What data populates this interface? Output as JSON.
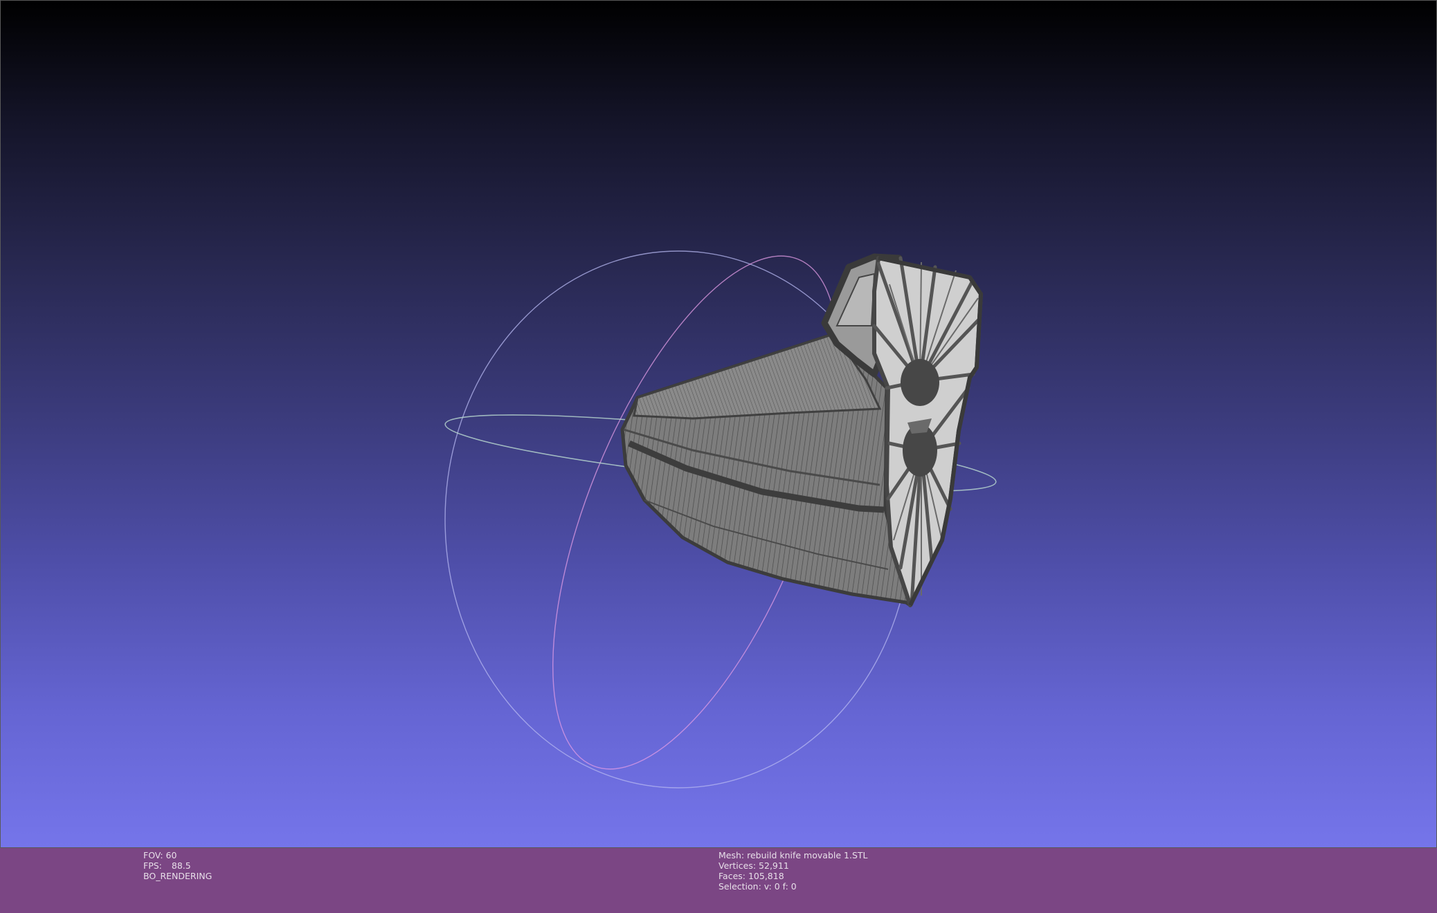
{
  "render_info": {
    "fov_label": "FOV:",
    "fov_value": "60",
    "fps_label": "FPS:",
    "fps_value": "88.5",
    "render_mode": "BO_RENDERING"
  },
  "mesh_info": {
    "mesh": "Mesh: rebuild knife movable 1.STL",
    "vertices": "Vertices: 52,911",
    "faces": "Faces: 105,818",
    "selection": "Selection: v: 0 f: 0"
  },
  "colors": {
    "status_bar": "#7b4684",
    "trackball_x": "#b9d8cf",
    "trackball_y": "#e09be4",
    "trackball_z": "#b5b7f0",
    "mesh_light": "#d0d0d0",
    "mesh_dark": "#474747"
  },
  "icons": [
    "trackball-icon"
  ]
}
